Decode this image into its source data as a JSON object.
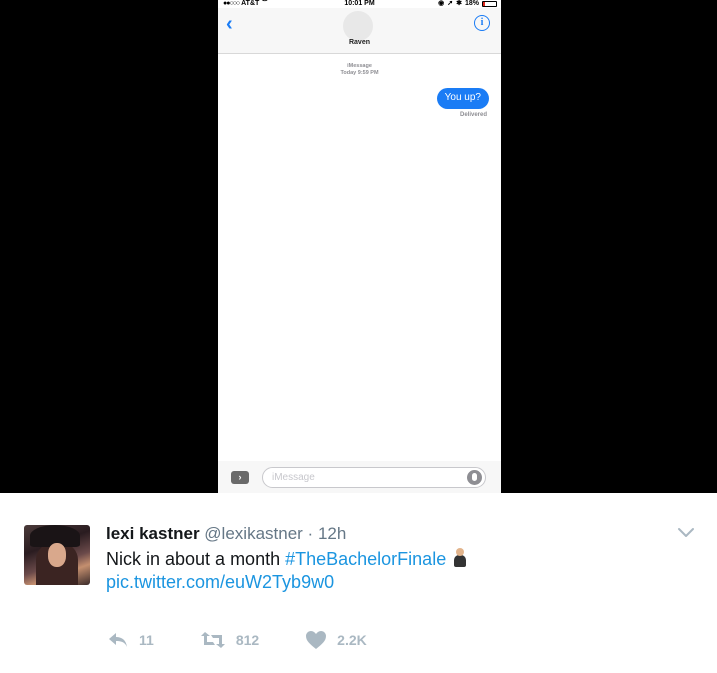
{
  "phone": {
    "status": {
      "carrier": "AT&T",
      "time": "10:01 PM",
      "battery": "18%",
      "battery_level": 0.18
    },
    "nav": {
      "contact_name": "Raven"
    },
    "thread": {
      "service": "iMessage",
      "timestamp": "Today 9:59 PM",
      "messages": [
        {
          "from": "me",
          "text": "You up?"
        }
      ],
      "delivery_status": "Delivered"
    },
    "composer": {
      "placeholder": "iMessage"
    }
  },
  "tweet": {
    "display_name": "lexi kastner",
    "handle": "@lexikastner",
    "separator": "·",
    "time": "12h",
    "text_prefix": "Nick in about a month ",
    "hashtag": "#TheBachelorFinale",
    "link": "pic.twitter.com/euW2Tyb9w0",
    "actions": {
      "reply_count": "11",
      "retweet_count": "812",
      "like_count": "2.2K"
    },
    "colors": {
      "link": "#1b95e0",
      "muted": "#657786",
      "action": "#aab8c2"
    }
  }
}
